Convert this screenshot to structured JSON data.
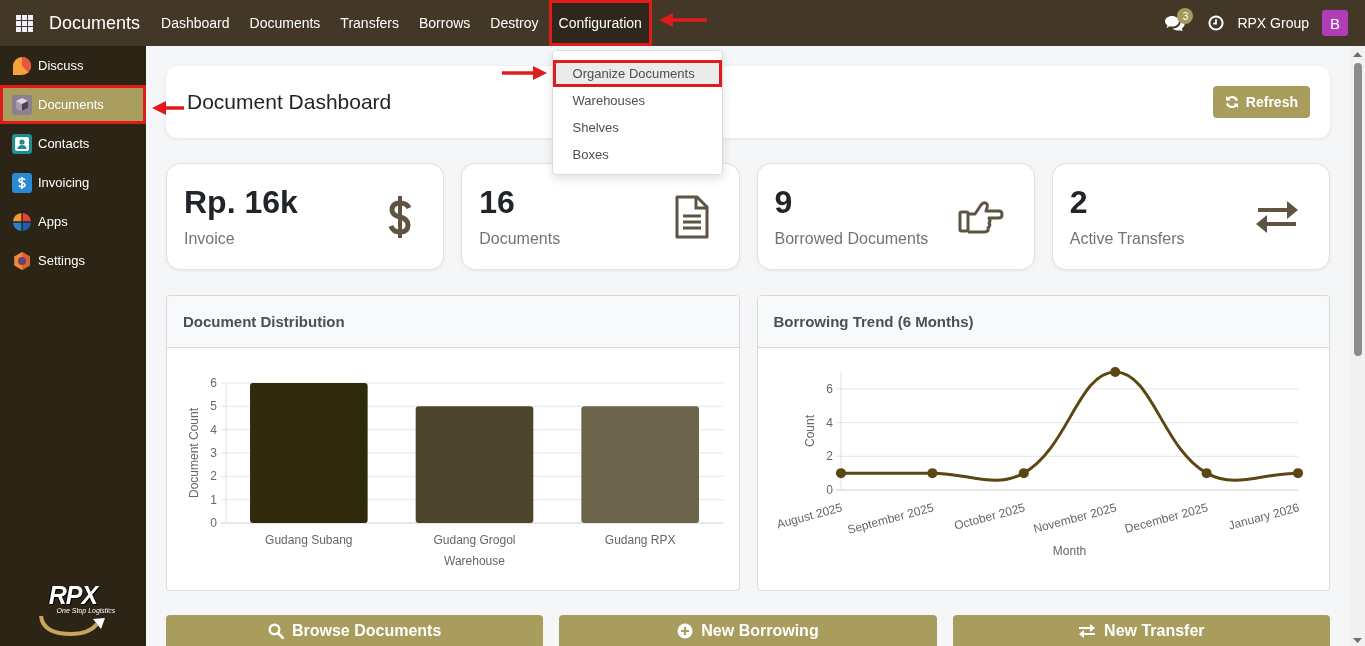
{
  "topbar": {
    "app_name": "Documents",
    "nav": [
      {
        "label": "Dashboard",
        "open": false,
        "marked": false
      },
      {
        "label": "Documents",
        "open": false,
        "marked": false
      },
      {
        "label": "Transfers",
        "open": false,
        "marked": false
      },
      {
        "label": "Borrows",
        "open": false,
        "marked": false
      },
      {
        "label": "Destroy",
        "open": false,
        "marked": false
      },
      {
        "label": "Configuration",
        "open": true,
        "marked": true,
        "menu": [
          {
            "label": "Organize Documents",
            "hovered": true,
            "marked": true
          },
          {
            "label": "Warehouses",
            "hovered": false,
            "marked": false
          },
          {
            "label": "Shelves",
            "hovered": false,
            "marked": false
          },
          {
            "label": "Boxes",
            "hovered": false,
            "marked": false
          }
        ]
      }
    ],
    "message_count": "3",
    "company": "RPX Group",
    "avatar": "B"
  },
  "sidebar": {
    "items": [
      {
        "label": "Discuss",
        "selected": false,
        "marked": false
      },
      {
        "label": "Documents",
        "selected": true,
        "marked": true
      },
      {
        "label": "Contacts",
        "selected": false,
        "marked": false
      },
      {
        "label": "Invoicing",
        "selected": false,
        "marked": false
      },
      {
        "label": "Apps",
        "selected": false,
        "marked": false
      },
      {
        "label": "Settings",
        "selected": false,
        "marked": false
      }
    ],
    "logo": {
      "wordmark": "RPX",
      "tagline": "One Stop Logistics"
    }
  },
  "header": {
    "title": "Document Dashboard",
    "refresh_button": "Refresh"
  },
  "stats": [
    {
      "value": "Rp. 16k",
      "label": "Invoice"
    },
    {
      "value": "16",
      "label": "Documents"
    },
    {
      "value": "9",
      "label": "Borrowed Documents"
    },
    {
      "value": "2",
      "label": "Active Transfers"
    }
  ],
  "charts": [
    {
      "title": "Document Distribution",
      "chart_data": {
        "type": "bar",
        "xlabel": "Warehouse",
        "ylabel": "Document Count",
        "categories": [
          "Gudang Subang",
          "Gudang Grogol",
          "Gudang RPX"
        ],
        "values": [
          6,
          5,
          5
        ],
        "colors": [
          "#2f2a0b",
          "#4b462b",
          "#6b654c"
        ],
        "ylim": [
          0,
          6
        ],
        "yticks": [
          0,
          1,
          2,
          3,
          4,
          5,
          6
        ],
        "grid": true
      }
    },
    {
      "title": "Borrowing Trend (6 Months)",
      "chart_data": {
        "type": "line",
        "xlabel": "Month",
        "ylabel": "Count",
        "categories": [
          "August 2025",
          "September 2025",
          "October 2025",
          "November 2025",
          "December 2025",
          "January 2026"
        ],
        "series": [
          {
            "color": "#5b4712",
            "marker": "circle",
            "values": [
              1,
              1,
              1,
              7,
              1,
              1
            ]
          }
        ],
        "ylim": [
          0,
          7
        ],
        "yticks": [
          0,
          2,
          4,
          6
        ],
        "grid": true
      }
    }
  ],
  "actions": [
    {
      "label": "Browse Documents"
    },
    {
      "label": "New Borrowing"
    },
    {
      "label": "New Transfer"
    }
  ]
}
